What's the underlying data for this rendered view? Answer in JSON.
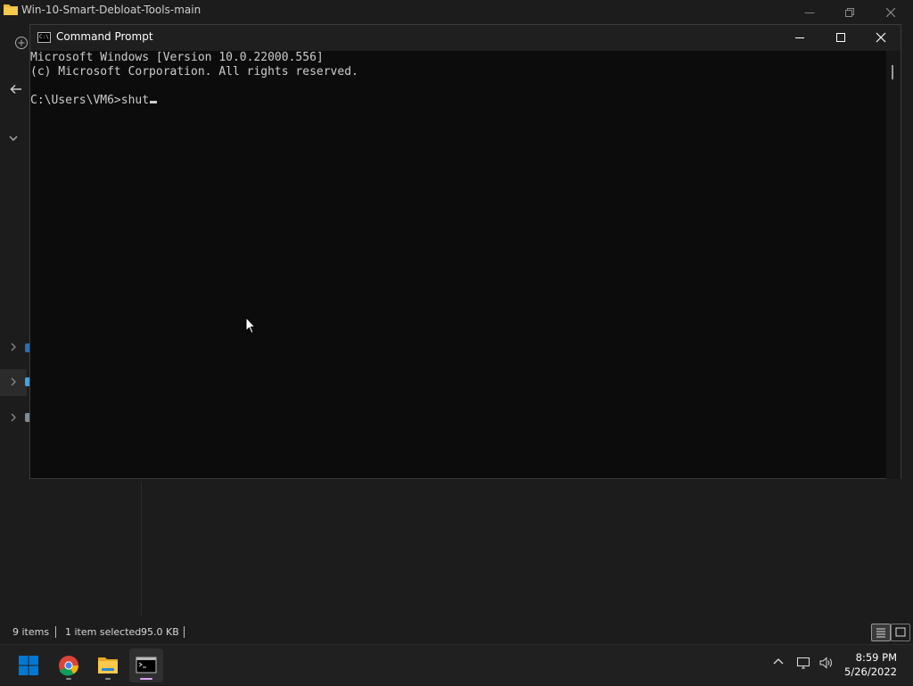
{
  "explorer": {
    "title": "Win-10-Smart-Debloat-Tools-main",
    "status": {
      "item_count": "9 items",
      "selection": "1 item selected",
      "size": "95.0 KB"
    }
  },
  "cmd": {
    "title": "Command Prompt",
    "icon_text": "C:\\",
    "lines": [
      "Microsoft Windows [Version 10.0.22000.556]",
      "(c) Microsoft Corporation. All rights reserved.",
      "",
      "C:\\Users\\VM6>shut"
    ]
  },
  "taskbar": {
    "apps": [
      {
        "name": "start-button",
        "icon": "windows-logo-icon"
      },
      {
        "name": "chrome",
        "icon": "chrome-icon"
      },
      {
        "name": "file-explorer",
        "icon": "folder-icon"
      },
      {
        "name": "command-prompt",
        "icon": "terminal-icon",
        "active": true
      }
    ],
    "time": "8:59 PM",
    "date": "5/26/2022"
  },
  "colors": {
    "accent_start": "#0078d4",
    "active_indicator": "#d9a5f5",
    "console_text": "#cccccc",
    "console_bg": "#0c0c0c"
  }
}
